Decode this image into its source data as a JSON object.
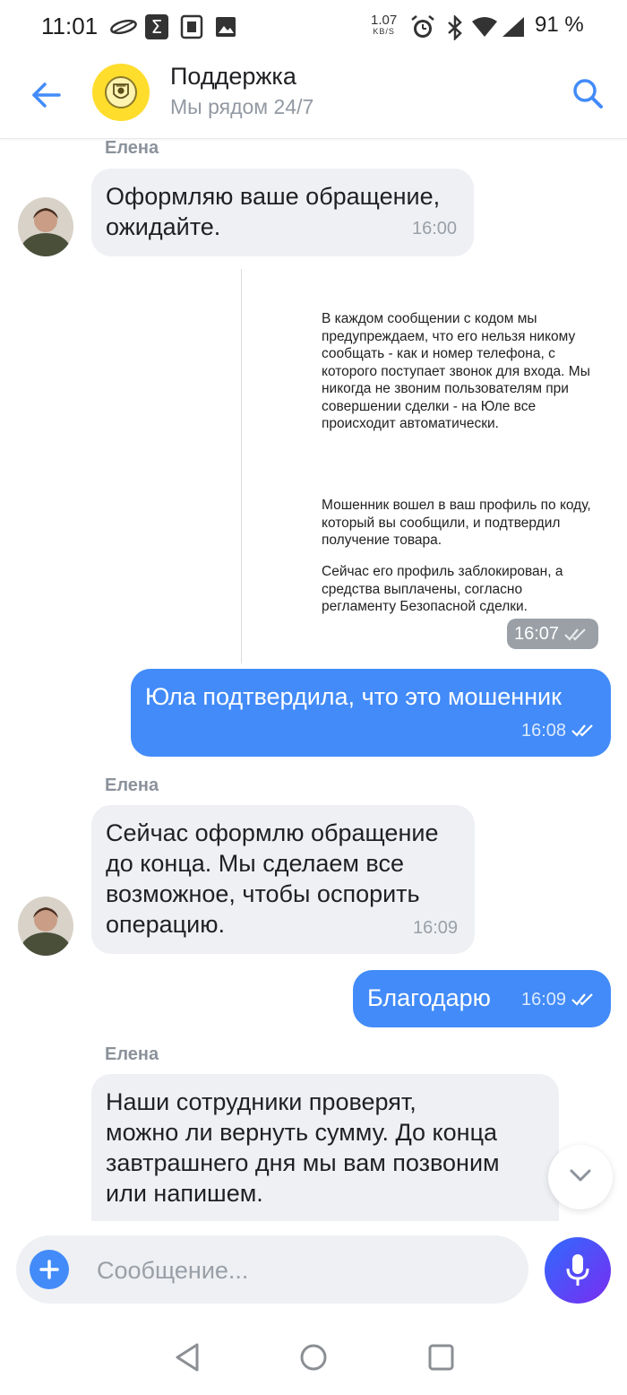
{
  "status_bar": {
    "time": "11:01",
    "net_speed": "1.07",
    "net_speed_unit": "KB/S",
    "battery": "91 %"
  },
  "header": {
    "title": "Поддержка",
    "subtitle": "Мы рядом 24/7",
    "logo_icon": "bank-logo-icon",
    "colors": {
      "accent": "#428bf9",
      "logo_bg": "#ffdd2d"
    }
  },
  "messages": [
    {
      "sender": "Елена",
      "lines": [
        "Оформляю ваше обращение,",
        "ожидайте."
      ],
      "time": "16:00",
      "direction": "incoming"
    },
    {
      "type": "attachment",
      "paragraphs": [
        "В каждом сообщении с кодом мы предупреждаем, что его нельзя никому сообщать - как и номер телефона, с которого поступает звонок для входа. Мы никогда не звоним пользователям при совершении сделки - на Юле все происходит автоматически.",
        "Мошенник вошел в ваш профиль по коду, который вы сообщили, и подтвердил получение товара.",
        "Сейчас его профиль заблокирован, а средства выплачены, согласно регламенту Безопасной сделки."
      ],
      "time": "16:07",
      "direction": "outgoing"
    },
    {
      "lines": [
        "Юла подтвердила, что это мошенник"
      ],
      "time": "16:08",
      "direction": "outgoing"
    },
    {
      "sender": "Елена",
      "lines": [
        "Сейчас оформлю обращение",
        "до конца. Мы сделаем все",
        "возможное, чтобы оспорить",
        "операцию."
      ],
      "time": "16:09",
      "direction": "incoming"
    },
    {
      "lines": [
        "Благодарю"
      ],
      "time": "16:09",
      "direction": "outgoing"
    },
    {
      "sender": "Елена",
      "lines": [
        "Наши сотрудники проверят,",
        "можно ли вернуть сумму. До конца",
        "завтрашнего дня мы вам позвоним",
        "или напишем."
      ],
      "direction": "incoming"
    }
  ],
  "composer": {
    "placeholder": "Сообщение..."
  }
}
